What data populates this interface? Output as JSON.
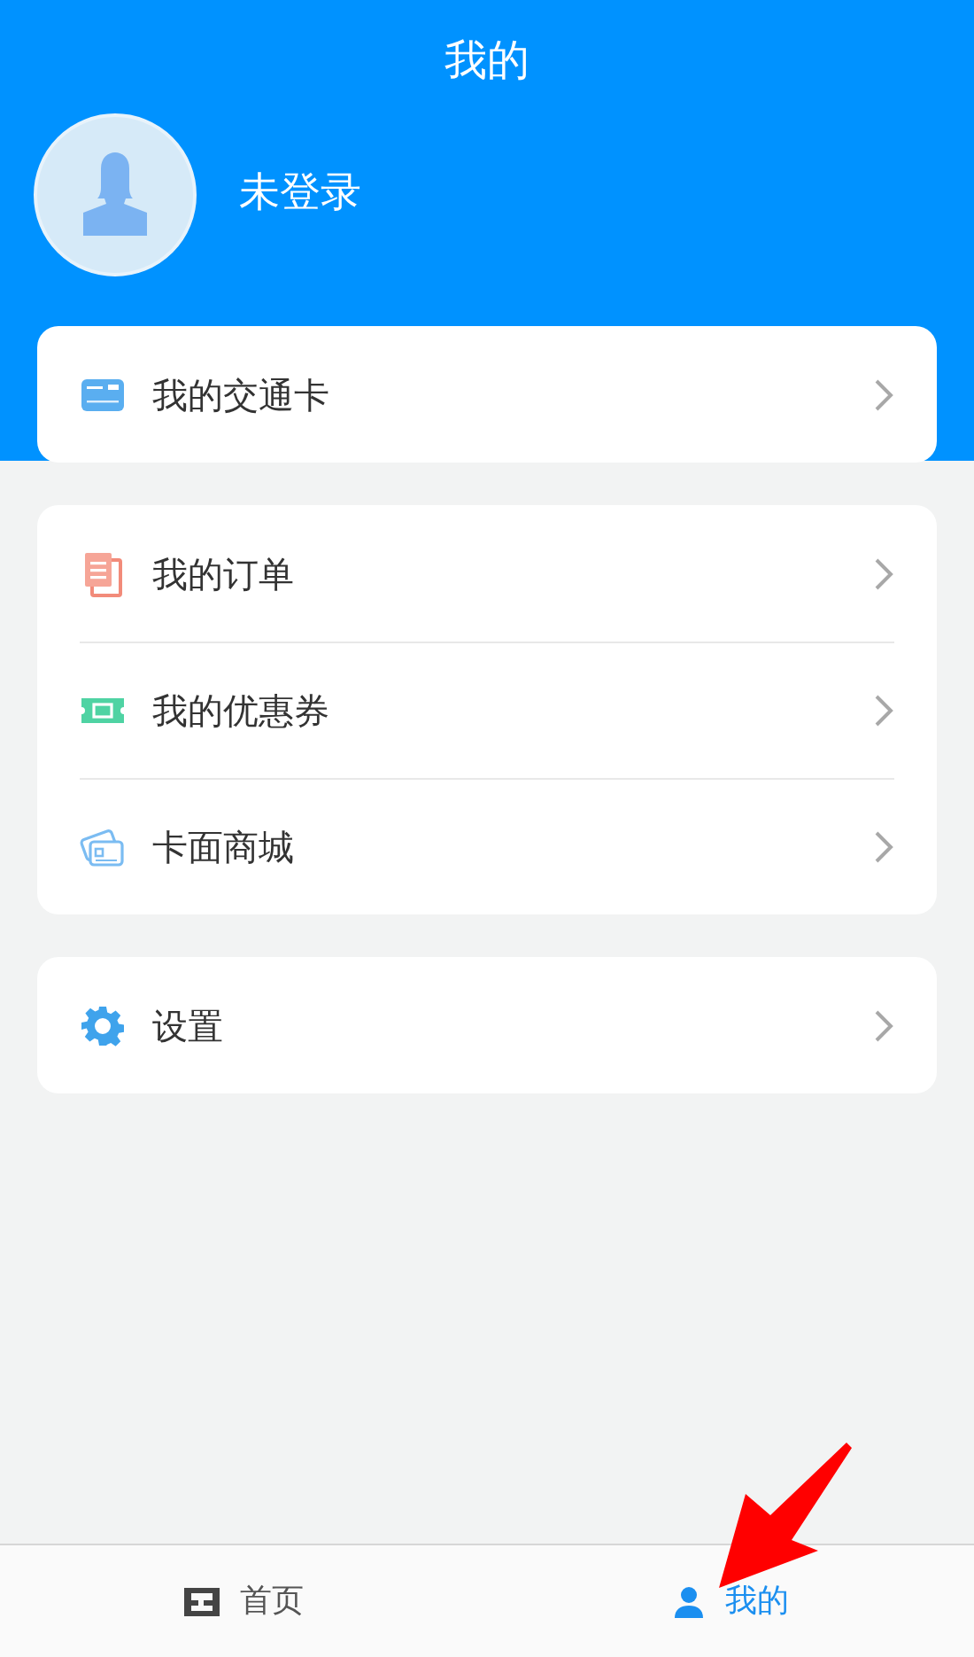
{
  "header": {
    "title": "我的",
    "user_name": "未登录"
  },
  "menu_groups": [
    {
      "items": [
        {
          "kind": "card",
          "label": "我的交通卡"
        }
      ]
    },
    {
      "items": [
        {
          "kind": "orders",
          "label": "我的订单"
        },
        {
          "kind": "coupon",
          "label": "我的优惠券"
        },
        {
          "kind": "shop",
          "label": "卡面商城"
        }
      ]
    },
    {
      "items": [
        {
          "kind": "settings",
          "label": "设置"
        }
      ]
    }
  ],
  "tab_bar": [
    {
      "kind": "home",
      "label": "首页",
      "selected": false
    },
    {
      "kind": "me",
      "label": "我的",
      "selected": true
    }
  ]
}
